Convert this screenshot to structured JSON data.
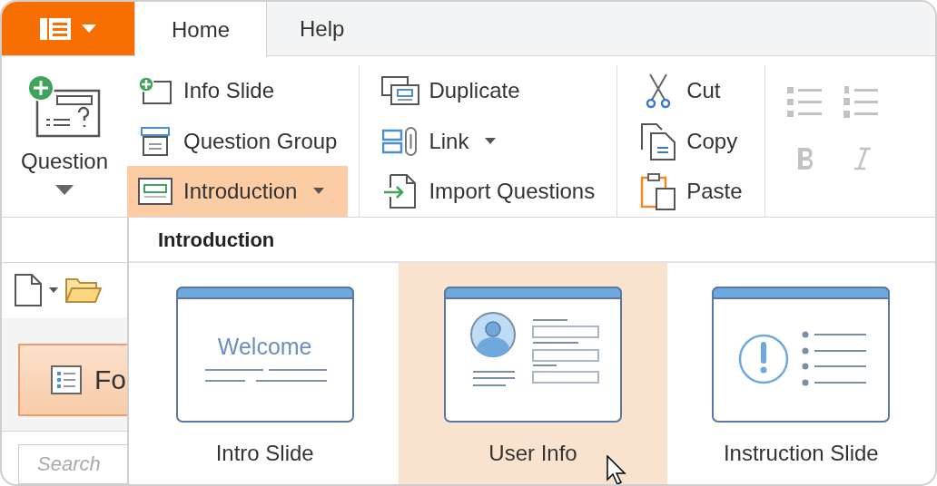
{
  "tabs": [
    {
      "label": "Home",
      "selected": true
    },
    {
      "label": "Help",
      "selected": false
    }
  ],
  "ribbon": {
    "groups": [
      {
        "large_button": {
          "label": "Question",
          "dropdown": true
        },
        "items": [
          {
            "label": "Info Slide",
            "dropdown": false,
            "open": false
          },
          {
            "label": "Question Group",
            "dropdown": false,
            "open": false
          },
          {
            "label": "Introduction",
            "dropdown": true,
            "open": true
          }
        ]
      },
      {
        "items": [
          {
            "label": "Duplicate",
            "dropdown": false,
            "open": false
          },
          {
            "label": "Link",
            "dropdown": true,
            "open": false
          },
          {
            "label": "Import Questions",
            "dropdown": false,
            "open": false
          }
        ]
      },
      {
        "items": [
          {
            "label": "Cut",
            "dropdown": false,
            "open": false
          },
          {
            "label": "Copy",
            "dropdown": false,
            "open": false
          },
          {
            "label": "Paste",
            "dropdown": false,
            "open": false
          }
        ]
      },
      {
        "kind": "format",
        "disabled": true
      }
    ]
  },
  "side_panel": {
    "button": {
      "label": "Fo",
      "selected": true
    },
    "search": {
      "placeholder": "Search"
    }
  },
  "gallery": {
    "title": "Introduction",
    "items": [
      {
        "label": "Intro Slide",
        "selected": false,
        "preview_text": "Welcome"
      },
      {
        "label": "User Info",
        "selected": true
      },
      {
        "label": "Instruction Slide",
        "selected": false
      }
    ]
  }
}
